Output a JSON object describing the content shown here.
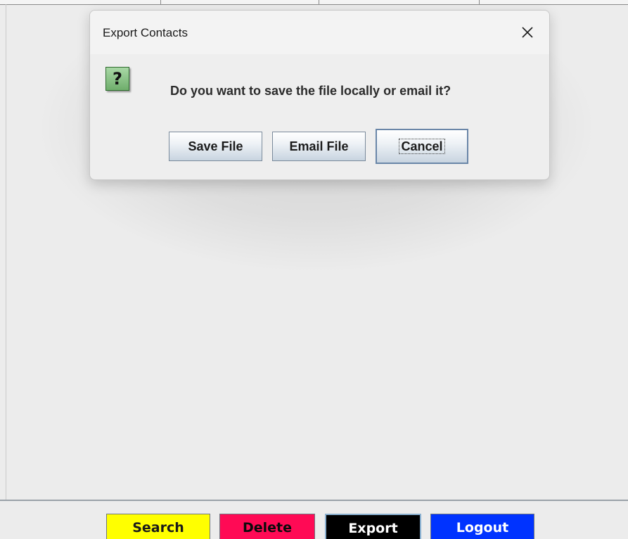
{
  "dialog": {
    "title": "Export Contacts",
    "message": "Do you want to save the file locally or email it?",
    "buttons": {
      "save_file": "Save File",
      "email_file": "Email File",
      "cancel": "Cancel"
    },
    "question_mark": "?"
  },
  "toolbar": {
    "search": "Search",
    "delete": "Delete",
    "export": "Export",
    "logout": "Logout"
  },
  "colors": {
    "search_bg": "#ffff00",
    "delete_bg": "#ff0a55",
    "export_bg": "#000000",
    "logout_bg": "#0033ff"
  },
  "icons": {
    "close": "close-icon",
    "question": "question-icon"
  }
}
